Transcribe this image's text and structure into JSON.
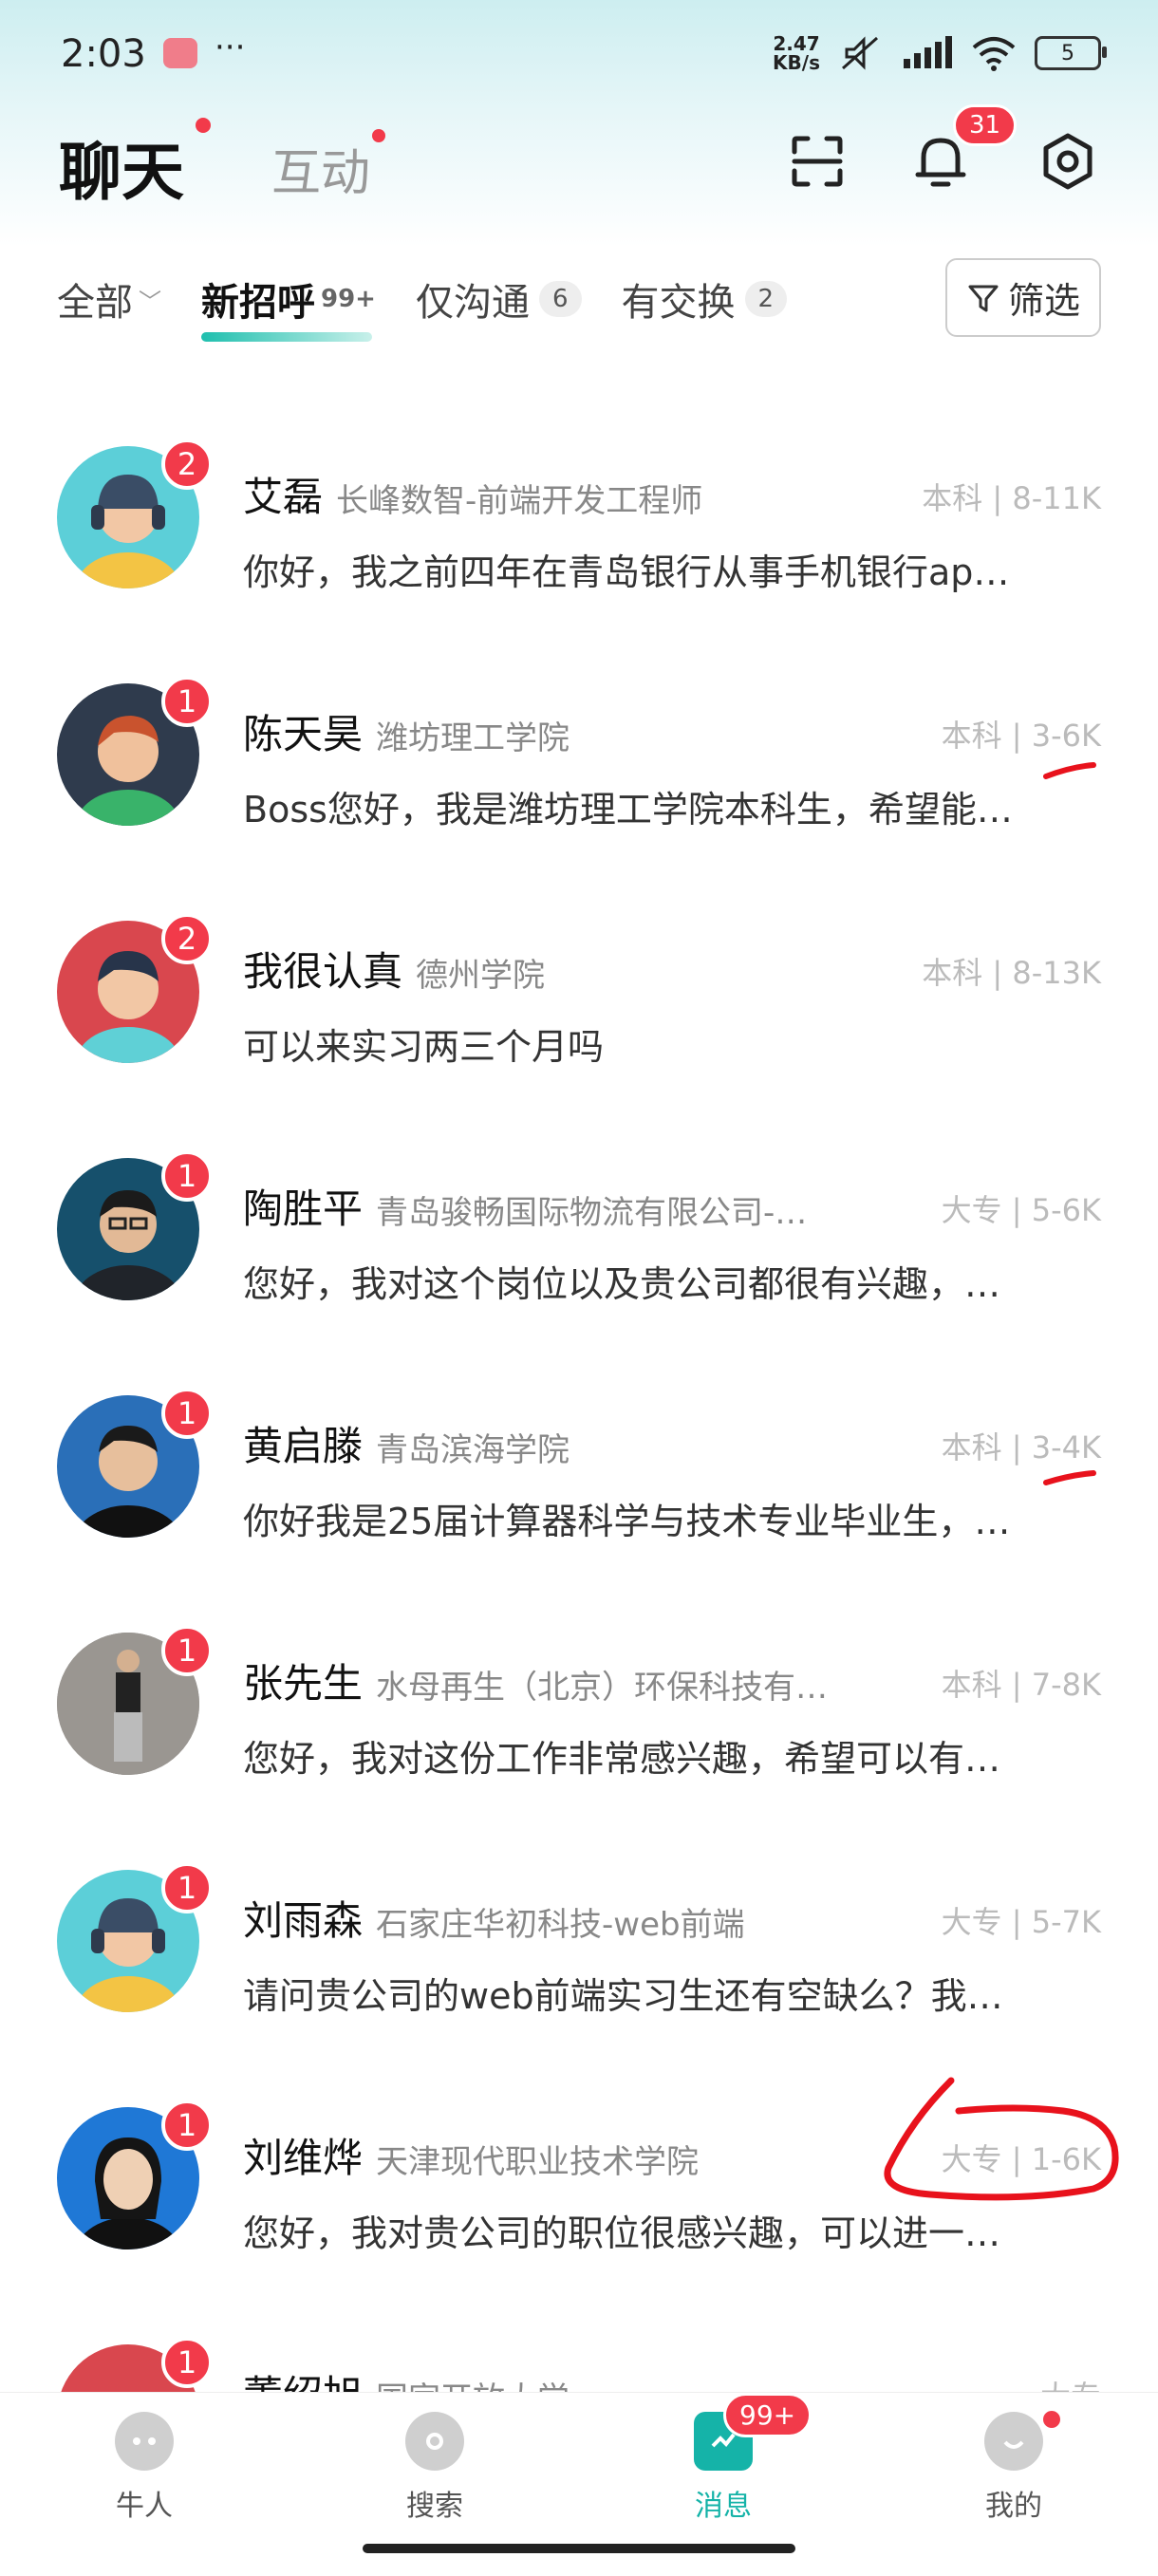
{
  "status_bar": {
    "time": "2:03",
    "more": "···",
    "speed_top": "2.47",
    "speed_unit": "KB/s",
    "battery": "5"
  },
  "header": {
    "title": "聊天",
    "interact_tab": "互动",
    "notify_count": "31"
  },
  "filters": {
    "all": "全部",
    "new_greet": "新招呼",
    "new_greet_count": "99+",
    "only_chat": "仅沟通",
    "only_chat_count": "6",
    "exchanged": "有交换",
    "exchanged_count": "2",
    "filter_btn": "筛选"
  },
  "chats": [
    {
      "name": "艾磊",
      "org": "长峰数智-前端开发工程师",
      "tag": "本科 | 8-11K",
      "msg": "你好，我之前四年在青岛银行从事手机银行ap…",
      "badge": "2"
    },
    {
      "name": "陈天昊",
      "org": "潍坊理工学院",
      "tag": "本科 | 3-6K",
      "msg": "Boss您好，我是潍坊理工学院本科生，希望能…",
      "badge": "1"
    },
    {
      "name": "我很认真",
      "org": "德州学院",
      "tag": "本科 | 8-13K",
      "msg": "可以来实习两三个月吗",
      "badge": "2"
    },
    {
      "name": "陶胜平",
      "org": "青岛骏畅国际物流有限公司-…",
      "tag": "大专 | 5-6K",
      "msg": "您好，我对这个岗位以及贵公司都很有兴趣，…",
      "badge": "1"
    },
    {
      "name": "黄启滕",
      "org": "青岛滨海学院",
      "tag": "本科 | 3-4K",
      "msg": "你好我是25届计算器科学与技术专业毕业生，…",
      "badge": "1"
    },
    {
      "name": "张先生",
      "org": "水母再生（北京）环保科技有…",
      "tag": "本科 | 7-8K",
      "msg": "您好，我对这份工作非常感兴趣，希望可以有…",
      "badge": "1"
    },
    {
      "name": "刘雨森",
      "org": "石家庄华初科技-web前端",
      "tag": "大专 | 5-7K",
      "msg": "请问贵公司的web前端实习生还有空缺么？我…",
      "badge": "1"
    },
    {
      "name": "刘维烨",
      "org": "天津现代职业技术学院",
      "tag": "大专 | 1-6K",
      "msg": "您好，我对贵公司的职位很感兴趣，可以进一…",
      "badge": "1"
    },
    {
      "name": "董绍旭",
      "org": "国家开放大学",
      "tag": "大专",
      "msg": "",
      "badge": "1"
    }
  ],
  "nav": {
    "people": "牛人",
    "search": "搜索",
    "messages": "消息",
    "messages_badge": "99+",
    "mine": "我的"
  }
}
